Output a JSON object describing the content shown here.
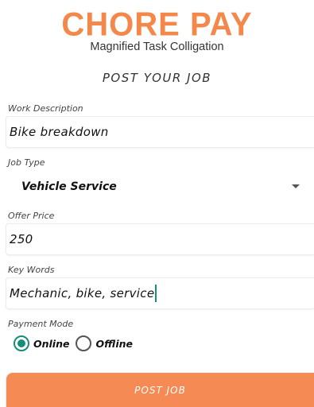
{
  "brand": {
    "logo": "CHORE PAY",
    "tagline": "Magnified Task Colligation",
    "accent_color": "#f4874a"
  },
  "page": {
    "title": "POST YOUR JOB"
  },
  "form": {
    "work_description": {
      "label": "Work Description",
      "value": "Bike breakdown"
    },
    "job_type": {
      "label": "Job Type",
      "selected": "Vehicle Service",
      "icon": "chevron-down-icon"
    },
    "offer_price": {
      "label": "Offer Price",
      "value": "250"
    },
    "key_words": {
      "label": "Key Words",
      "value": "Mechanic, bike, service"
    },
    "payment_mode": {
      "label": "Payment Mode",
      "options": [
        {
          "label": "Online",
          "checked": true
        },
        {
          "label": "Offline",
          "checked": false
        }
      ],
      "checked_color": "#1a8c7a"
    },
    "submit": {
      "label": "POST JOB",
      "color": "#f58a55"
    }
  }
}
